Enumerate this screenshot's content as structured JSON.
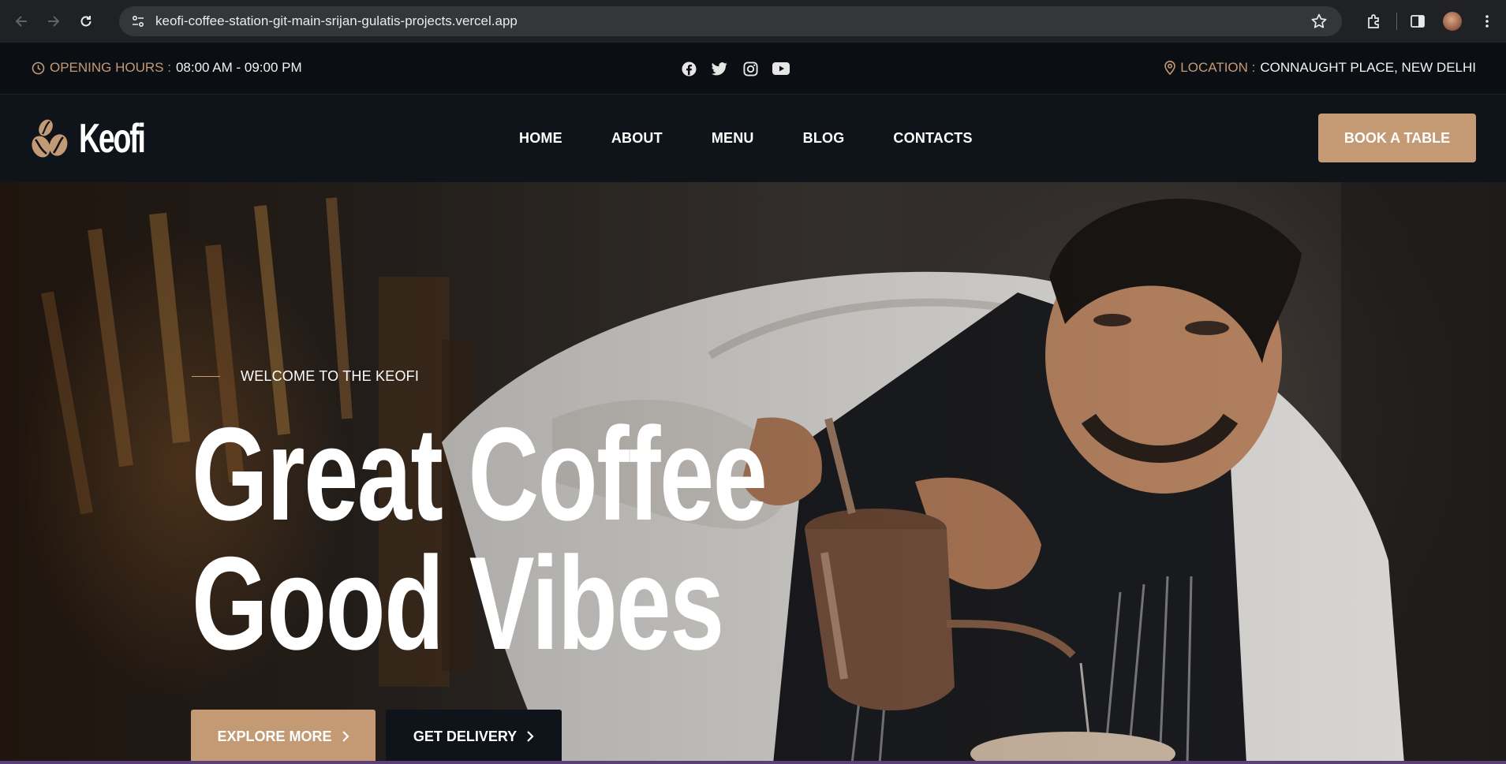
{
  "browser": {
    "url": "keofi-coffee-station-git-main-srijan-gulatis-projects.vercel.app",
    "icons": [
      "back-icon",
      "forward-icon",
      "reload-icon",
      "site-settings-icon",
      "bookmark-star-icon",
      "extensions-icon",
      "side-panel-icon",
      "profile-avatar",
      "more-menu-icon"
    ]
  },
  "infobar": {
    "hours_label": "OPENING HOURS :",
    "hours_value": "08:00 AM - 09:00 PM",
    "socials": [
      "facebook-icon",
      "twitter-icon",
      "instagram-icon",
      "youtube-icon"
    ],
    "location_label": "LOCATION :",
    "location_value": "CONNAUGHT PLACE, NEW DELHI"
  },
  "header": {
    "logo_text": "Keofi",
    "menu": [
      {
        "label": "HOME"
      },
      {
        "label": "ABOUT"
      },
      {
        "label": "MENU"
      },
      {
        "label": "BLOG"
      },
      {
        "label": "CONTACTS"
      }
    ],
    "cta": "BOOK A TABLE"
  },
  "hero": {
    "eyebrow": "WELCOME TO THE KEOFI",
    "headline_line1": "Great Coffee",
    "headline_line2": "Good Vibes",
    "primary_btn": "EXPLORE MORE",
    "secondary_btn": "GET DELIVERY",
    "image": "barista-pouring-coffee-photo"
  },
  "colors": {
    "accent": "#c49a74",
    "dark": "#0f141a",
    "text": "#ffffff"
  }
}
